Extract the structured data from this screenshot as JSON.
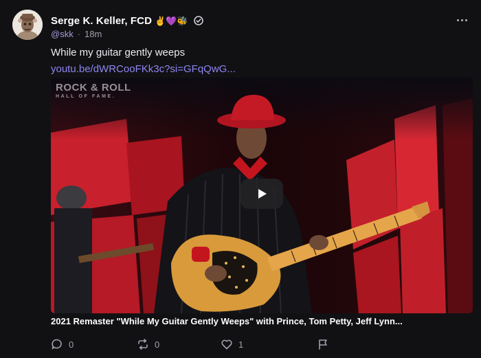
{
  "author": {
    "display_name": "Serge K. Keller, FCD",
    "name_emojis": "✌️💜🐝",
    "handle": "@skk",
    "separator": "·",
    "time": "18m",
    "verified_icon": "verified-check-icon",
    "avatar_icon": "avatar-illustration"
  },
  "post": {
    "text": "While my guitar gently weeps",
    "link": "youtu.be/dWRCooFKk3c?si=GFqQwG...",
    "more_icon": "more-horizontal-icon"
  },
  "embed": {
    "watermark_top": "ROCK & ROLL",
    "watermark_bottom": "HALL OF FAME.",
    "play_icon": "play-icon",
    "title": "2021 Remaster \"While My Guitar Gently Weeps\" with Prince, Tom Petty, Jeff Lynn..."
  },
  "actions": {
    "reply": {
      "icon": "comment-icon",
      "count": "0"
    },
    "repost": {
      "icon": "repost-icon",
      "count": "0"
    },
    "like": {
      "icon": "heart-icon",
      "count": "1"
    },
    "report": {
      "icon": "flag-icon"
    }
  },
  "colors": {
    "background": "#111114",
    "link": "#8f86f0",
    "handle": "#a59bd8",
    "muted": "#a0a0ae"
  }
}
